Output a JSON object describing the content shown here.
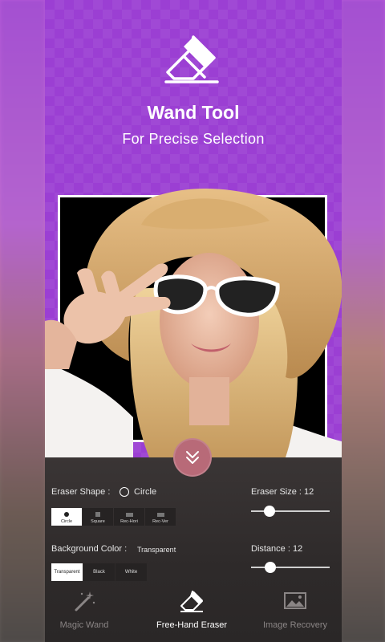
{
  "hero": {
    "title": "Wand Tool",
    "subtitle": "For Precise Selection",
    "icon": "eraser-icon"
  },
  "panel": {
    "eraser_shape_label": "Eraser Shape :",
    "eraser_shape_value": "Circle",
    "shapes": [
      "Circle",
      "Square",
      "Rec-Hori",
      "Rec-Ver"
    ],
    "active_shape": "Circle",
    "eraser_size_label": "Eraser Size : 12",
    "eraser_size_value": 12,
    "background_color_label": "Background Color :",
    "background_color_value": "Transparent",
    "backgrounds": [
      "Transparent",
      "Black",
      "White"
    ],
    "active_background": "Transparent",
    "distance_label": "Distance : 12",
    "distance_value": 12
  },
  "tabs": [
    {
      "label": "Magic Wand",
      "icon": "magic-wand-icon"
    },
    {
      "label": "Free-Hand Eraser",
      "icon": "eraser-icon"
    },
    {
      "label": "Image Recovery",
      "icon": "image-icon"
    }
  ],
  "active_tab": "Free-Hand Eraser",
  "colors": {
    "background_purple": "#9b3fd3",
    "panel": "#2e2a2a",
    "collapse_button": "#b86a78"
  }
}
